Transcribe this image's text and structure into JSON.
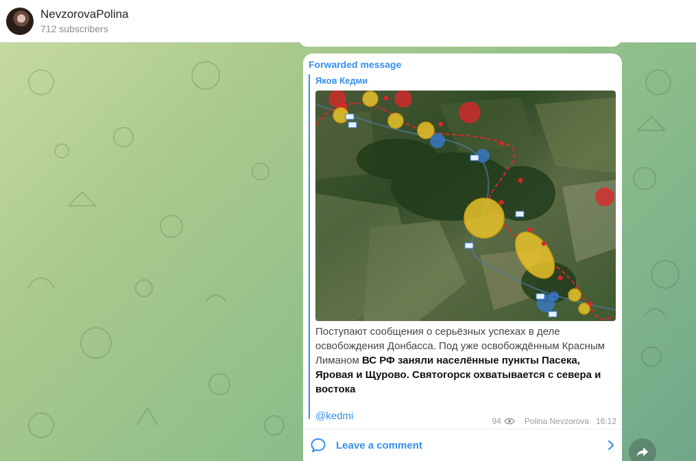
{
  "header": {
    "channel_name": "NevzorovaPolina",
    "subscribers": "712 subscribers"
  },
  "message": {
    "forwarded_label": "Forwarded message",
    "forwarded_author": "Яков Кедми",
    "text_plain": "Поступают сообщения о серьёзных успехах в деле освобождения Донбасса. Под уже освобождённым Красным Лиманом ",
    "text_bold": "ВС РФ заняли населённые пункты Пасека, Яровая и Щурово. Святогорск охватывается с севера и востока",
    "mention": "@kedmi",
    "views": "94",
    "post_author": "Polina Nevzorova",
    "time": "16:12"
  },
  "comments": {
    "label": "Leave a comment"
  },
  "icons": {
    "views": "eye-icon",
    "comment": "comment-bubble-icon",
    "chevron": "chevron-right-icon",
    "share": "share-arrow-icon"
  },
  "colors": {
    "accent": "#3390ec",
    "map_red": "#e0242a",
    "map_yellow": "#e8c22a",
    "map_blue": "#3a7bd5"
  }
}
